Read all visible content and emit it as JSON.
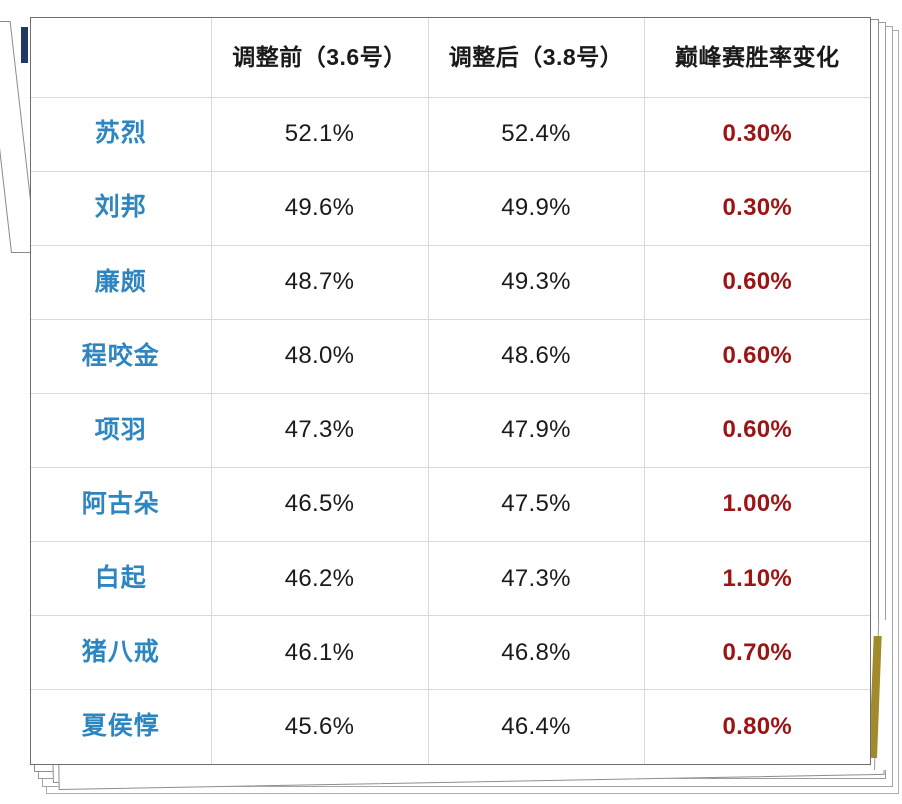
{
  "table": {
    "columns": [
      {
        "key": "hero",
        "label": ""
      },
      {
        "key": "before",
        "label": "调整前（3.6号）"
      },
      {
        "key": "after",
        "label": "调整后（3.8号）"
      },
      {
        "key": "delta",
        "label": "巅峰赛胜率变化"
      }
    ],
    "rows": [
      {
        "hero": "苏烈",
        "before": "52.1%",
        "after": "52.4%",
        "delta": "0.30%"
      },
      {
        "hero": "刘邦",
        "before": "49.6%",
        "after": "49.9%",
        "delta": "0.30%"
      },
      {
        "hero": "廉颇",
        "before": "48.7%",
        "after": "49.3%",
        "delta": "0.60%"
      },
      {
        "hero": "程咬金",
        "before": "48.0%",
        "after": "48.6%",
        "delta": "0.60%"
      },
      {
        "hero": "项羽",
        "before": "47.3%",
        "after": "47.9%",
        "delta": "0.60%"
      },
      {
        "hero": "阿古朵",
        "before": "46.5%",
        "after": "47.5%",
        "delta": "1.00%"
      },
      {
        "hero": "白起",
        "before": "46.2%",
        "after": "47.3%",
        "delta": "1.10%"
      },
      {
        "hero": "猪八戒",
        "before": "46.1%",
        "after": "46.8%",
        "delta": "0.70%"
      },
      {
        "hero": "夏侯惇",
        "before": "45.6%",
        "after": "46.4%",
        "delta": "0.80%"
      }
    ]
  },
  "colors": {
    "hero_name": "#2e86c1",
    "delta_value": "#9c1414",
    "header_text": "#1a1a1a",
    "rate_value": "#1a1a1a",
    "grid_line": "#d9d9d9",
    "card_border": "#6e6e6e",
    "left_tab": "#1f3864",
    "right_gold": "#a08a2a",
    "page_background": "#ffffff"
  }
}
